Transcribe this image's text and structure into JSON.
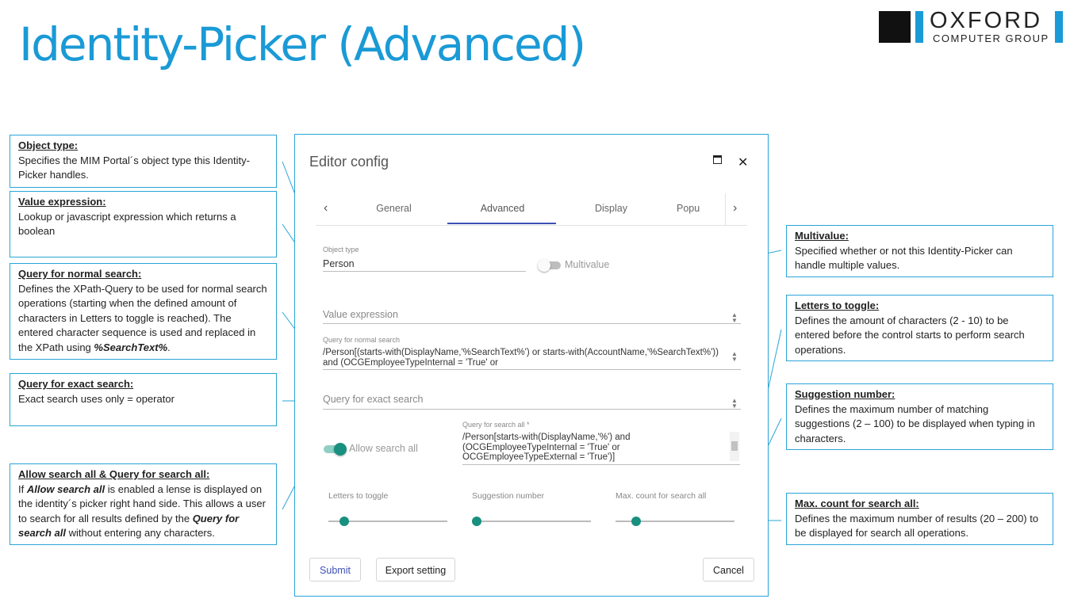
{
  "page": {
    "title": "Identity-Picker (Advanced)"
  },
  "logo": {
    "line1": "OXFORD",
    "line2": "COMPUTER GROUP"
  },
  "notes": {
    "object_type": {
      "heading": "Object type:",
      "text": "Specifies the MIM Portal´s object type this Identity-Picker handles."
    },
    "value_expression": {
      "heading": "Value expression:",
      "text": "Lookup or javascript expression which returns a boolean"
    },
    "query_normal": {
      "heading": "Query for normal search:",
      "text": "Defines the XPath-Query to be used for normal search operations (starting when the defined amount of characters in Letters to toggle is reached). The entered character sequence is used and replaced in the XPath using ",
      "emph": "%SearchText%",
      "tail": "."
    },
    "query_exact": {
      "heading": "Query for exact search:",
      "text": "Exact search uses only = operator"
    },
    "allow_search_all": {
      "heading": "Allow search all & Query for search all:",
      "p1": "If ",
      "e1": "Allow search all",
      "p2": " is enabled a lense is displayed on the identity´s picker right hand side. This allows a user to search for all results defined by the ",
      "e2": "Query for search all",
      "p3": " without entering any characters."
    },
    "multivalue": {
      "heading": "Multivalue:",
      "text": "Specified whether or not this Identity-Picker can handle multiple values."
    },
    "letters_to_toggle": {
      "heading": "Letters to toggle:",
      "text": "Defines the amount of characters (2 - 10) to be entered before the control starts to perform search operations."
    },
    "suggestion_number": {
      "heading": "Suggestion number:",
      "text": "Defines the maximum number of matching suggestions (2 – 100) to be displayed when typing in characters."
    },
    "max_count": {
      "heading": "Max. count for search all:",
      "text": "Defines the maximum number of results (20 – 200) to be displayed for search all operations."
    }
  },
  "dialog": {
    "title": "Editor config",
    "maximize_icon": "square-icon",
    "close_glyph": "✕",
    "tabs": [
      "General",
      "Advanced",
      "Display",
      "Popu"
    ],
    "active_tab": "Advanced",
    "object_type": {
      "label": "Object type",
      "value": "Person"
    },
    "multivalue": {
      "label": "Multivalue",
      "enabled": false
    },
    "value_expression": {
      "placeholder": "Value expression"
    },
    "query_normal": {
      "label": "Query for normal search",
      "value": "/Person[(starts-with(DisplayName,'%SearchText%') or starts-with(AccountName,'%SearchText%')) and (OCGEmployeeTypeInternal = 'True' or"
    },
    "query_exact": {
      "placeholder": "Query for exact search"
    },
    "allow_search_all": {
      "label": "Allow search all",
      "enabled": true
    },
    "query_search_all": {
      "label": "Query for search all *",
      "value": "/Person[starts-with(DisplayName,'%') and (OCGEmployeeTypeInternal = 'True' or OCGEmployeeTypeExternal = 'True')]"
    },
    "sliders": [
      {
        "label": "Letters to toggle",
        "fraction": 0.13
      },
      {
        "label": "Suggestion number",
        "fraction": 0.04
      },
      {
        "label": "Max. count for search all",
        "fraction": 0.17
      }
    ],
    "buttons": {
      "submit": "Submit",
      "export": "Export setting",
      "cancel": "Cancel"
    },
    "colors": {
      "accent": "#3f51b5",
      "toggle_on": "#18907f",
      "frame": "#2aa4d8"
    }
  }
}
